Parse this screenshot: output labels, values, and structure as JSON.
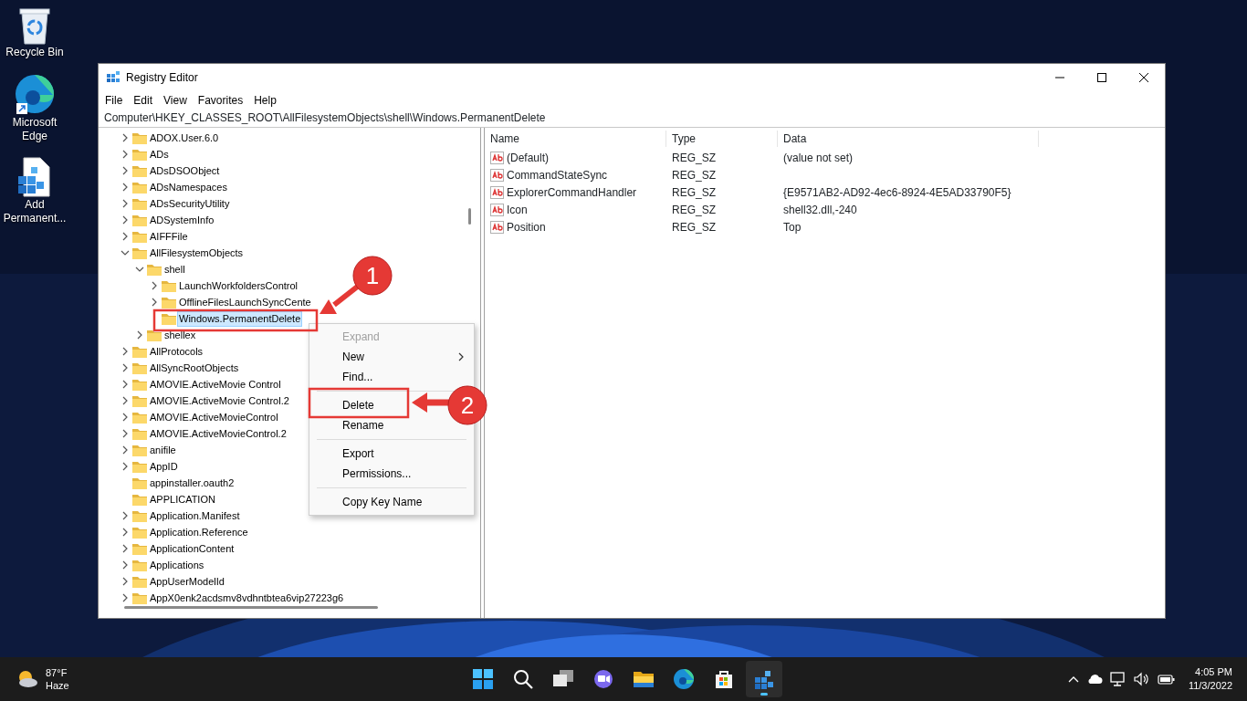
{
  "desktop_icons": [
    {
      "kind": "recycle",
      "label": "Recycle Bin"
    },
    {
      "kind": "edge",
      "label": "Microsoft Edge"
    },
    {
      "kind": "regfile",
      "label": "Add Permanent..."
    }
  ],
  "window": {
    "title": "Registry Editor",
    "menu": [
      "File",
      "Edit",
      "View",
      "Favorites",
      "Help"
    ],
    "address": "Computer\\HKEY_CLASSES_ROOT\\AllFilesystemObjects\\shell\\Windows.PermanentDelete",
    "tree": [
      {
        "label": "ADOX.User.6.0",
        "kind": "branch",
        "expanded": false,
        "selected": false
      },
      {
        "label": "ADs",
        "kind": "branch",
        "expanded": false,
        "selected": false
      },
      {
        "label": "ADsDSOObject",
        "kind": "branch",
        "expanded": false,
        "selected": false
      },
      {
        "label": "ADsNamespaces",
        "kind": "branch",
        "expanded": false,
        "selected": false
      },
      {
        "label": "ADsSecurityUtility",
        "kind": "branch",
        "expanded": false,
        "selected": false
      },
      {
        "label": "ADSystemInfo",
        "kind": "branch",
        "expanded": false,
        "selected": false
      },
      {
        "label": "AIFFFile",
        "kind": "branch",
        "expanded": false,
        "selected": false
      },
      {
        "label": "AllFilesystemObjects",
        "kind": "branch",
        "expanded": true,
        "selected": false,
        "children": [
          {
            "label": "shell",
            "kind": "branch",
            "expanded": true,
            "selected": false,
            "children": [
              {
                "label": "LaunchWorkfoldersControl",
                "kind": "branch",
                "expanded": false,
                "selected": false
              },
              {
                "label": "OfflineFilesLaunchSyncCente",
                "kind": "branch",
                "expanded": false,
                "selected": false
              },
              {
                "label": "Windows.PermanentDelete",
                "kind": "leaf",
                "selected": true
              }
            ]
          },
          {
            "label": "shellex",
            "kind": "branch",
            "expanded": false,
            "selected": false
          }
        ]
      },
      {
        "label": "AllProtocols",
        "kind": "branch",
        "expanded": false,
        "selected": false
      },
      {
        "label": "AllSyncRootObjects",
        "kind": "branch",
        "expanded": false,
        "selected": false
      },
      {
        "label": "AMOVIE.ActiveMovie Control",
        "kind": "branch",
        "expanded": false,
        "selected": false
      },
      {
        "label": "AMOVIE.ActiveMovie Control.2",
        "kind": "branch",
        "expanded": false,
        "selected": false
      },
      {
        "label": "AMOVIE.ActiveMovieControl",
        "kind": "branch",
        "expanded": false,
        "selected": false
      },
      {
        "label": "AMOVIE.ActiveMovieControl.2",
        "kind": "branch",
        "expanded": false,
        "selected": false
      },
      {
        "label": "anifile",
        "kind": "branch",
        "expanded": false,
        "selected": false
      },
      {
        "label": "AppID",
        "kind": "branch",
        "expanded": false,
        "selected": false
      },
      {
        "label": "appinstaller.oauth2",
        "kind": "leaf",
        "selected": false
      },
      {
        "label": "APPLICATION",
        "kind": "leaf",
        "selected": false
      },
      {
        "label": "Application.Manifest",
        "kind": "branch",
        "expanded": false,
        "selected": false
      },
      {
        "label": "Application.Reference",
        "kind": "branch",
        "expanded": false,
        "selected": false
      },
      {
        "label": "ApplicationContent",
        "kind": "branch",
        "expanded": false,
        "selected": false
      },
      {
        "label": "Applications",
        "kind": "branch",
        "expanded": false,
        "selected": false
      },
      {
        "label": "AppUserModelId",
        "kind": "branch",
        "expanded": false,
        "selected": false
      },
      {
        "label": "AppX0enk2acdsmv8vdhntbtea6vip27223g6",
        "kind": "branch",
        "expanded": false,
        "selected": false
      }
    ],
    "values": {
      "columns": [
        "Name",
        "Type",
        "Data"
      ],
      "rows": [
        {
          "name": "(Default)",
          "type": "REG_SZ",
          "data": "(value not set)"
        },
        {
          "name": "CommandStateSync",
          "type": "REG_SZ",
          "data": ""
        },
        {
          "name": "ExplorerCommandHandler",
          "type": "REG_SZ",
          "data": "{E9571AB2-AD92-4ec6-8924-4E5AD33790F5}"
        },
        {
          "name": "Icon",
          "type": "REG_SZ",
          "data": "shell32.dll,-240"
        },
        {
          "name": "Position",
          "type": "REG_SZ",
          "data": "Top"
        }
      ]
    },
    "context_menu": [
      {
        "kind": "item",
        "label": "Expand",
        "disabled": true,
        "submenu": false
      },
      {
        "kind": "item",
        "label": "New",
        "disabled": false,
        "submenu": true
      },
      {
        "kind": "item",
        "label": "Find...",
        "disabled": false,
        "submenu": false
      },
      {
        "kind": "separator"
      },
      {
        "kind": "item",
        "label": "Delete",
        "disabled": false,
        "submenu": false
      },
      {
        "kind": "item",
        "label": "Rename",
        "disabled": false,
        "submenu": false
      },
      {
        "kind": "separator"
      },
      {
        "kind": "item",
        "label": "Export",
        "disabled": false,
        "submenu": false
      },
      {
        "kind": "item",
        "label": "Permissions...",
        "disabled": false,
        "submenu": false
      },
      {
        "kind": "separator"
      },
      {
        "kind": "item",
        "label": "Copy Key Name",
        "disabled": false,
        "submenu": false
      }
    ]
  },
  "annotations": [
    {
      "label": "1"
    },
    {
      "label": "2"
    }
  ],
  "taskbar": {
    "weather": {
      "temperature": "87°F",
      "condition": "Haze"
    },
    "apps": [
      {
        "kind": "start",
        "active": false
      },
      {
        "kind": "search",
        "active": false
      },
      {
        "kind": "taskview",
        "active": false
      },
      {
        "kind": "chat",
        "active": false
      },
      {
        "kind": "explorer",
        "active": false
      },
      {
        "kind": "edge",
        "active": false
      },
      {
        "kind": "store",
        "active": false
      },
      {
        "kind": "regedit",
        "active": true
      }
    ],
    "time": "4:05 PM",
    "date": "11/3/2022"
  }
}
